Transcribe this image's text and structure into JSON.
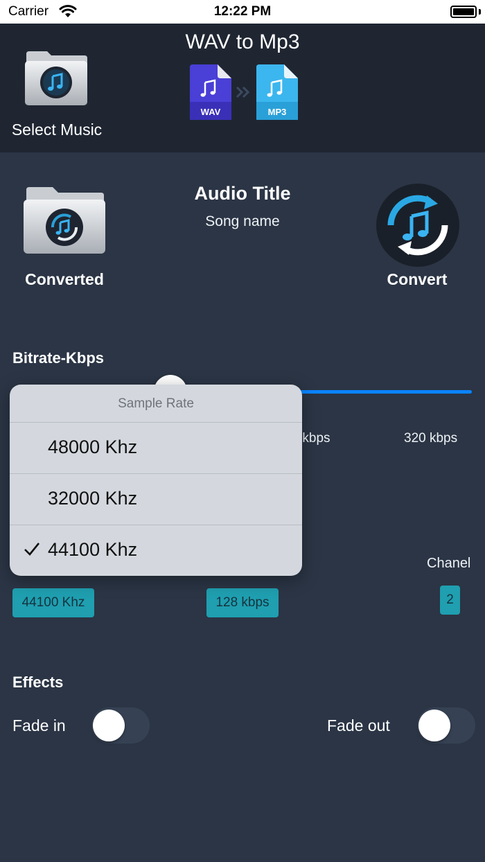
{
  "status_bar": {
    "carrier": "Carrier",
    "time": "12:22 PM"
  },
  "header": {
    "title": "WAV to Mp3",
    "select_music_label": "Select Music",
    "from_format": "WAV",
    "to_format": "MP3"
  },
  "main": {
    "converted_label": "Converted",
    "audio_title": "Audio Title",
    "song_name": "Song name",
    "convert_label": "Convert"
  },
  "bitrate": {
    "heading": "Bitrate-Kbps",
    "tick_labels": [
      "92 kbps",
      "320 kbps"
    ],
    "accent_color": "#0a84ff"
  },
  "sample_rate_menu": {
    "title": "Sample Rate",
    "options": [
      {
        "label": "48000 Khz",
        "selected": false
      },
      {
        "label": "32000 Khz",
        "selected": false
      },
      {
        "label": "44100 Khz",
        "selected": true
      }
    ]
  },
  "settings": {
    "sample_rate_value": "44100 Khz",
    "bitrate_value": "128 kbps",
    "channel_label": "Chanel",
    "channel_value": "2",
    "chip_color": "#1f9fb0"
  },
  "effects": {
    "heading": "Effects",
    "fade_in_label": "Fade in",
    "fade_out_label": "Fade out",
    "fade_in_on": false,
    "fade_out_on": false
  }
}
